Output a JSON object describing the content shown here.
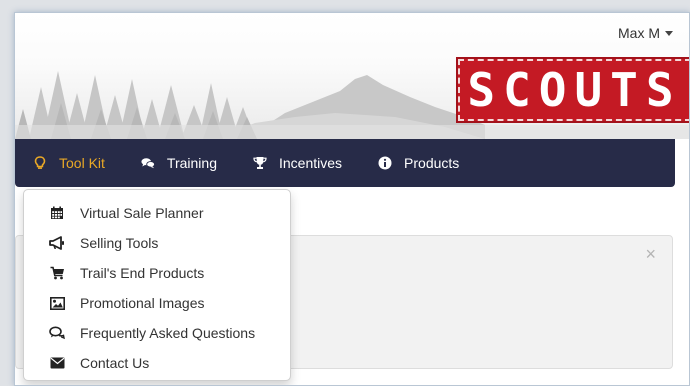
{
  "header": {
    "user_name": "Max M",
    "logo_text": "SCOUTS"
  },
  "nav": {
    "items": [
      {
        "label": "Tool Kit",
        "icon": "lightbulb-icon",
        "active": true
      },
      {
        "label": "Training",
        "icon": "chat-bubbles-icon"
      },
      {
        "label": "Incentives",
        "icon": "trophy-icon"
      },
      {
        "label": "Products",
        "icon": "info-circle-icon"
      }
    ]
  },
  "toolkit_menu": {
    "items": [
      {
        "label": "Virtual Sale Planner",
        "icon": "calendar-icon"
      },
      {
        "label": "Selling Tools",
        "icon": "bullhorn-icon"
      },
      {
        "label": "Trail's End Products",
        "icon": "shopping-cart-icon"
      },
      {
        "label": "Promotional Images",
        "icon": "image-icon"
      },
      {
        "label": "Frequently Asked Questions",
        "icon": "question-bubble-icon"
      },
      {
        "label": "Contact Us",
        "icon": "envelope-icon"
      }
    ]
  },
  "alert": {
    "close_symbol": "×"
  },
  "colors": {
    "navbar_bg": "#272b48",
    "active_nav": "#e9a826",
    "logo_red": "#c41a24"
  }
}
